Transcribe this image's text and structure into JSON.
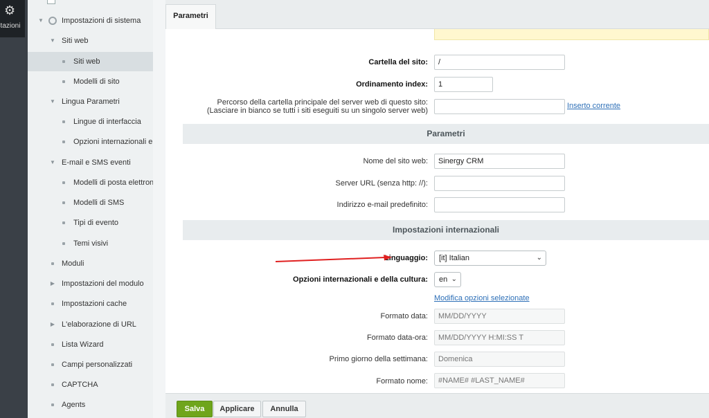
{
  "rail": {
    "label": "ostazioni"
  },
  "sidebar": {
    "items": [
      {
        "label": "Impostazioni di sistema"
      },
      {
        "label": "Siti web"
      },
      {
        "label": "Siti web"
      },
      {
        "label": "Modelli di sito"
      },
      {
        "label": "Lingua Parametri"
      },
      {
        "label": "Lingue di interfaccia"
      },
      {
        "label": "Opzioni internazionali e c"
      },
      {
        "label": "E-mail e SMS eventi"
      },
      {
        "label": "Modelli di posta elettroni"
      },
      {
        "label": "Modelli di SMS"
      },
      {
        "label": "Tipi di evento"
      },
      {
        "label": "Temi visivi"
      },
      {
        "label": "Moduli"
      },
      {
        "label": "Impostazioni del modulo"
      },
      {
        "label": "Impostazioni cache"
      },
      {
        "label": "L'elaborazione di URL"
      },
      {
        "label": "Lista Wizard"
      },
      {
        "label": "Campi personalizzati"
      },
      {
        "label": "CAPTCHA"
      },
      {
        "label": "Agents"
      }
    ]
  },
  "tabs": [
    {
      "label": "Parametri"
    }
  ],
  "form": {
    "site_folder_label": "Cartella del sito:",
    "site_folder_value": "/",
    "index_order_label": "Ordinamento index:",
    "index_order_value": "1",
    "root_path_label_1": "Percorso della cartella principale del server web di questo sito:",
    "root_path_label_2": "(Lasciare in bianco se tutti i siti eseguiti su un singolo server web)",
    "root_path_value": "",
    "insert_current_link": "Inserto corrente",
    "section_params": "Parametri",
    "site_name_label": "Nome del sito web:",
    "site_name_value": "Sinergy CRM",
    "server_url_label": "Server URL (senza http: //):",
    "server_url_value": "",
    "email_label": "Indirizzo e-mail predefinito:",
    "email_value": "",
    "section_intl": "Impostazioni internazionali",
    "language_label": "Linguaggio:",
    "language_value": "[it] Italian",
    "culture_label": "Opzioni internazionali e della cultura:",
    "culture_value": "en",
    "modify_link": "Modifica opzioni selezionate",
    "date_format_label": "Formato data:",
    "date_format_placeholder": "MM/DD/YYYY",
    "datetime_format_label": "Formato data-ora:",
    "datetime_format_placeholder": "MM/DD/YYYY H:MI:SS T",
    "first_day_label": "Primo giorno della settimana:",
    "first_day_placeholder": "Domenica",
    "name_format_label": "Formato nome:",
    "name_format_placeholder": "#NAME# #LAST_NAME#"
  },
  "footer": {
    "save": "Salva",
    "apply": "Applicare",
    "cancel": "Annulla"
  },
  "colors": {
    "save_button": "#6fa51c",
    "link": "#2d6fb7",
    "arrow": "#e02020"
  }
}
